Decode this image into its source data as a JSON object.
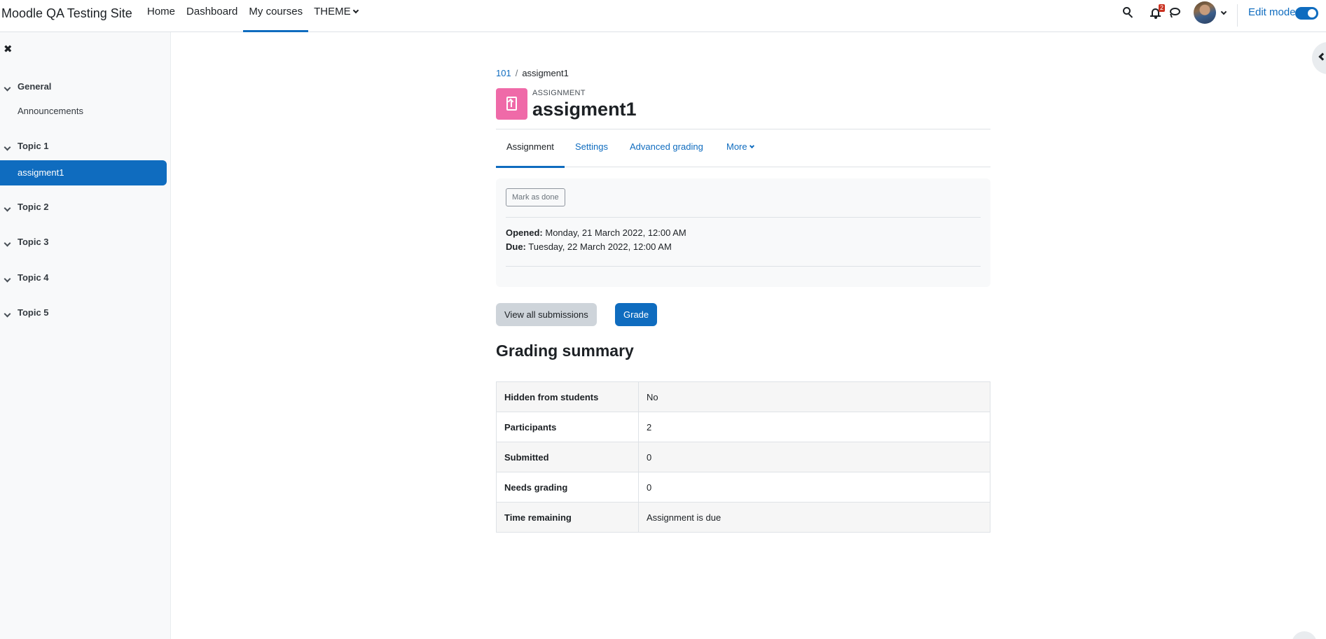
{
  "site": {
    "name": "Moodle QA Testing Site"
  },
  "primary_nav": {
    "items": [
      {
        "label": "Home"
      },
      {
        "label": "Dashboard"
      },
      {
        "label": "My courses"
      },
      {
        "label": "THEME"
      }
    ],
    "active": "My courses"
  },
  "user_menu": {
    "notification_count": "2",
    "edit_mode_label": "Edit mode",
    "edit_mode_on": true
  },
  "icons": {
    "search": "search-icon",
    "notifications": "bell-icon",
    "messages": "chat-bubble-icon",
    "drawer_close": "close-icon"
  },
  "course_index": {
    "sections": [
      {
        "title": "General",
        "items": [
          "Announcements"
        ]
      },
      {
        "title": "Topic 1",
        "items": [
          "assigment1"
        ]
      },
      {
        "title": "Topic 2",
        "items": []
      },
      {
        "title": "Topic 3",
        "items": []
      },
      {
        "title": "Topic 4",
        "items": []
      },
      {
        "title": "Topic 5",
        "items": []
      }
    ],
    "active_item": "assigment1"
  },
  "breadcrumb": {
    "course": "101",
    "current": "assigment1"
  },
  "activity": {
    "type_label": "ASSIGNMENT",
    "title": "assigment1",
    "icon_color": "#ef6aa8"
  },
  "secondary_nav": {
    "tabs": [
      "Assignment",
      "Settings",
      "Advanced grading",
      "More"
    ],
    "active": "Assignment"
  },
  "completion": {
    "mark_done_label": "Mark as done"
  },
  "dates": {
    "opened_label": "Opened:",
    "opened_value": "Monday, 21 March 2022, 12:00 AM",
    "due_label": "Due:",
    "due_value": "Tuesday, 22 March 2022, 12:00 AM"
  },
  "actions": {
    "view_all_label": "View all submissions",
    "grade_label": "Grade"
  },
  "grading_summary": {
    "heading": "Grading summary",
    "rows": [
      {
        "label": "Hidden from students",
        "value": "No"
      },
      {
        "label": "Participants",
        "value": "2"
      },
      {
        "label": "Submitted",
        "value": "0"
      },
      {
        "label": "Needs grading",
        "value": "0"
      },
      {
        "label": "Time remaining",
        "value": "Assignment is due"
      }
    ]
  },
  "colors": {
    "brand_blue": "#0f6cbf",
    "badge_red": "#ca3120"
  }
}
